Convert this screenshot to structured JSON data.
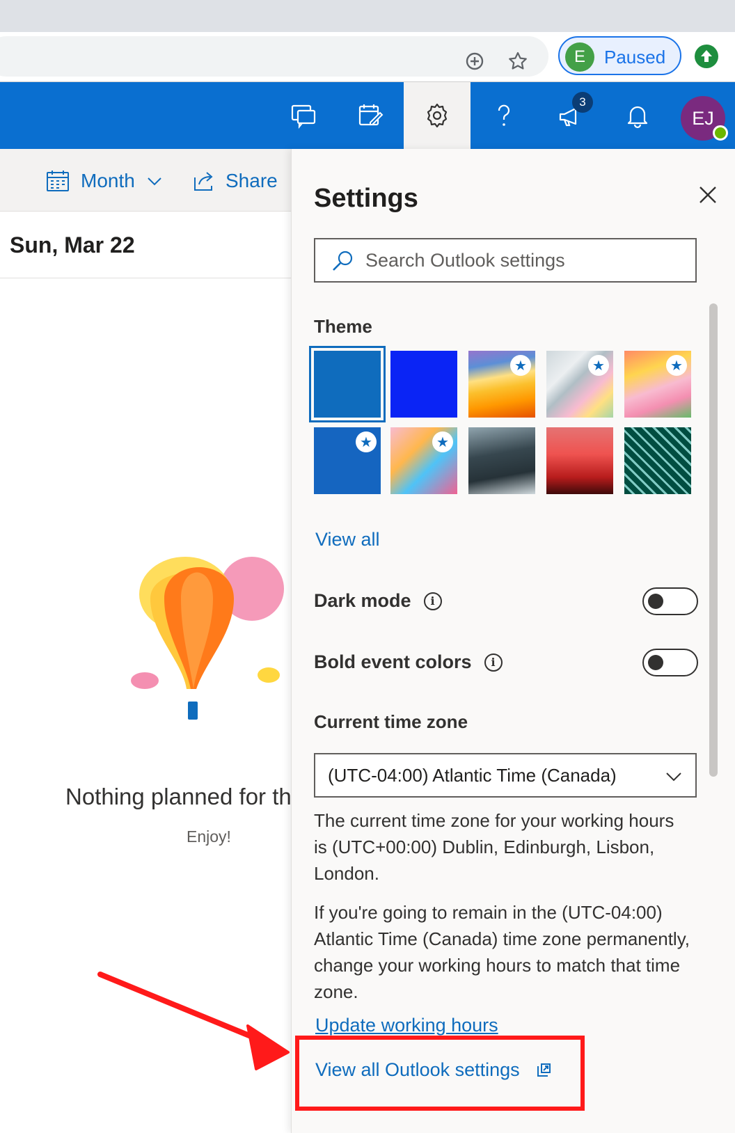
{
  "browser": {
    "profile_initial": "E",
    "profile_status": "Paused",
    "add_icon": "plus-circle-icon",
    "bookmark_icon": "star-icon",
    "update_icon": "arrow-up-icon"
  },
  "header": {
    "buttons": [
      {
        "icon": "chat-feedback-icon"
      },
      {
        "icon": "calendar-check-icon"
      },
      {
        "icon": "gear-icon",
        "active": true
      },
      {
        "icon": "help-icon"
      },
      {
        "icon": "megaphone-icon",
        "badge": "3"
      },
      {
        "icon": "bell-icon"
      }
    ],
    "avatar_initials": "EJ",
    "accent": "#0a6fd0"
  },
  "calendar": {
    "view_label": "Month",
    "share_label": "Share",
    "date_title": "Sun, Mar 22",
    "empty_title": "Nothing planned for the day",
    "empty_subtitle": "Enjoy!"
  },
  "settings": {
    "title": "Settings",
    "search_placeholder": "Search Outlook settings",
    "theme_label": "Theme",
    "themes": [
      {
        "name": "blue",
        "selected": true,
        "premium": false
      },
      {
        "name": "bright-blue",
        "selected": false,
        "premium": true
      },
      {
        "name": "yellow-waves",
        "selected": false,
        "premium": true
      },
      {
        "name": "rainbow-ribbons",
        "selected": false,
        "premium": true
      },
      {
        "name": "unicorn",
        "selected": false,
        "premium": true
      },
      {
        "name": "school-supplies",
        "selected": false,
        "premium": true
      },
      {
        "name": "game-board",
        "selected": false,
        "premium": true
      },
      {
        "name": "mountain",
        "selected": false,
        "premium": false
      },
      {
        "name": "palm-sunset",
        "selected": false,
        "premium": false
      },
      {
        "name": "circuit-board",
        "selected": false,
        "premium": false
      }
    ],
    "view_all_label": "View all",
    "dark_mode_label": "Dark mode",
    "dark_mode_on": false,
    "bold_colors_label": "Bold event colors",
    "bold_colors_on": false,
    "timezone_label": "Current time zone",
    "timezone_value": "(UTC-04:00) Atlantic Time (Canada)",
    "timezone_note": "The current time zone for your working hours is (UTC+00:00) Dublin, Edinburgh, Lisbon, London.",
    "timezone_advice": "If you're going to remain in the (UTC-04:00) Atlantic Time (Canada) time zone permanently, change your working hours to match that time zone.",
    "update_hours_link": "Update working hours",
    "view_all_settings_link": "View all Outlook settings"
  },
  "annotation": {
    "color": "#ff1a1a"
  }
}
